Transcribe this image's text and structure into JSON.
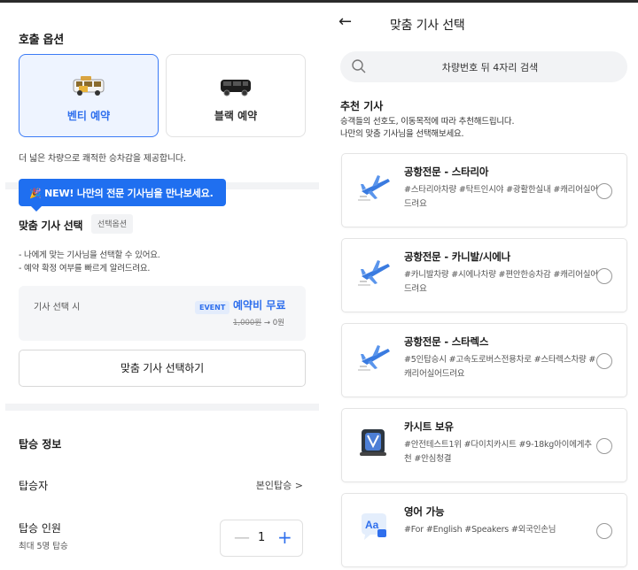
{
  "left": {
    "call_option_title": "호출 옵션",
    "options": [
      {
        "label": "벤티 예약",
        "selected": true
      },
      {
        "label": "블랙 예약",
        "selected": false
      }
    ],
    "option_desc": "더 넓은 차량으로 쾌적한 승차감을 제공합니다.",
    "tooltip": "🎉 NEW! 나만의 전문 기사님을 만나보세요.",
    "driver_select_title": "맞춤 기사 선택",
    "driver_select_chip": "선택옵션",
    "bullets": [
      "- 나에게 맞는 기사님을 선택할 수 있어요.",
      "- 예약 확정 여부를 빠르게 알려드려요."
    ],
    "price": {
      "label": "기사 선택 시",
      "event": "EVENT",
      "free_text": "예약비 무료",
      "old_price": "1,000원",
      "arrow": "→",
      "new_price": "0원"
    },
    "select_button": "맞춤 기사 선택하기",
    "boarding_title": "탑승 정보",
    "passenger_label": "탑승자",
    "passenger_value": "본인탑승 >",
    "count_label": "탑승 인원",
    "count_note": "최대 5명 탑승",
    "count_value": "1",
    "minus": "—",
    "plus": "+"
  },
  "right": {
    "back_icon": "←",
    "title": "맞춤 기사 선택",
    "search_placeholder": "차량번호 뒤 4자리 검색",
    "rec_title": "추천 기사",
    "rec_desc_1": "승객들의 선호도, 이동목적에 따라 추천해드립니다.",
    "rec_desc_2": "나만의 맞춤 기사님을 선택해보세요.",
    "drivers": [
      {
        "name": "공항전문 - 스타리아",
        "tags": "#스타리아차량 #탁트인시야 #광활한실내 #캐리어실어드려요",
        "icon": "airplane-icon"
      },
      {
        "name": "공항전문 - 카니발/시에나",
        "tags": "#카니발차량 #시에나차량 #편안한승차감 #캐리어실어드려요",
        "icon": "airplane-icon"
      },
      {
        "name": "공항전문 - 스타렉스",
        "tags": "#5인탑승시 #고속도로버스전용차로 #스타렉스차량 #캐리어실어드려요",
        "icon": "airplane-icon"
      },
      {
        "name": "카시트 보유",
        "tags": "#안전테스트1위 #다이치카시트 #9-18kg아이에게추천 #안심청결",
        "icon": "car-seat-icon"
      },
      {
        "name": "영어 가능",
        "tags": "#For #English #Speakers #외국인손님",
        "icon": "translate-icon"
      }
    ]
  },
  "colors": {
    "accent": "#2f6fed",
    "tooltip": "#1f6ff0",
    "card_active_bg": "#eef4ff"
  }
}
